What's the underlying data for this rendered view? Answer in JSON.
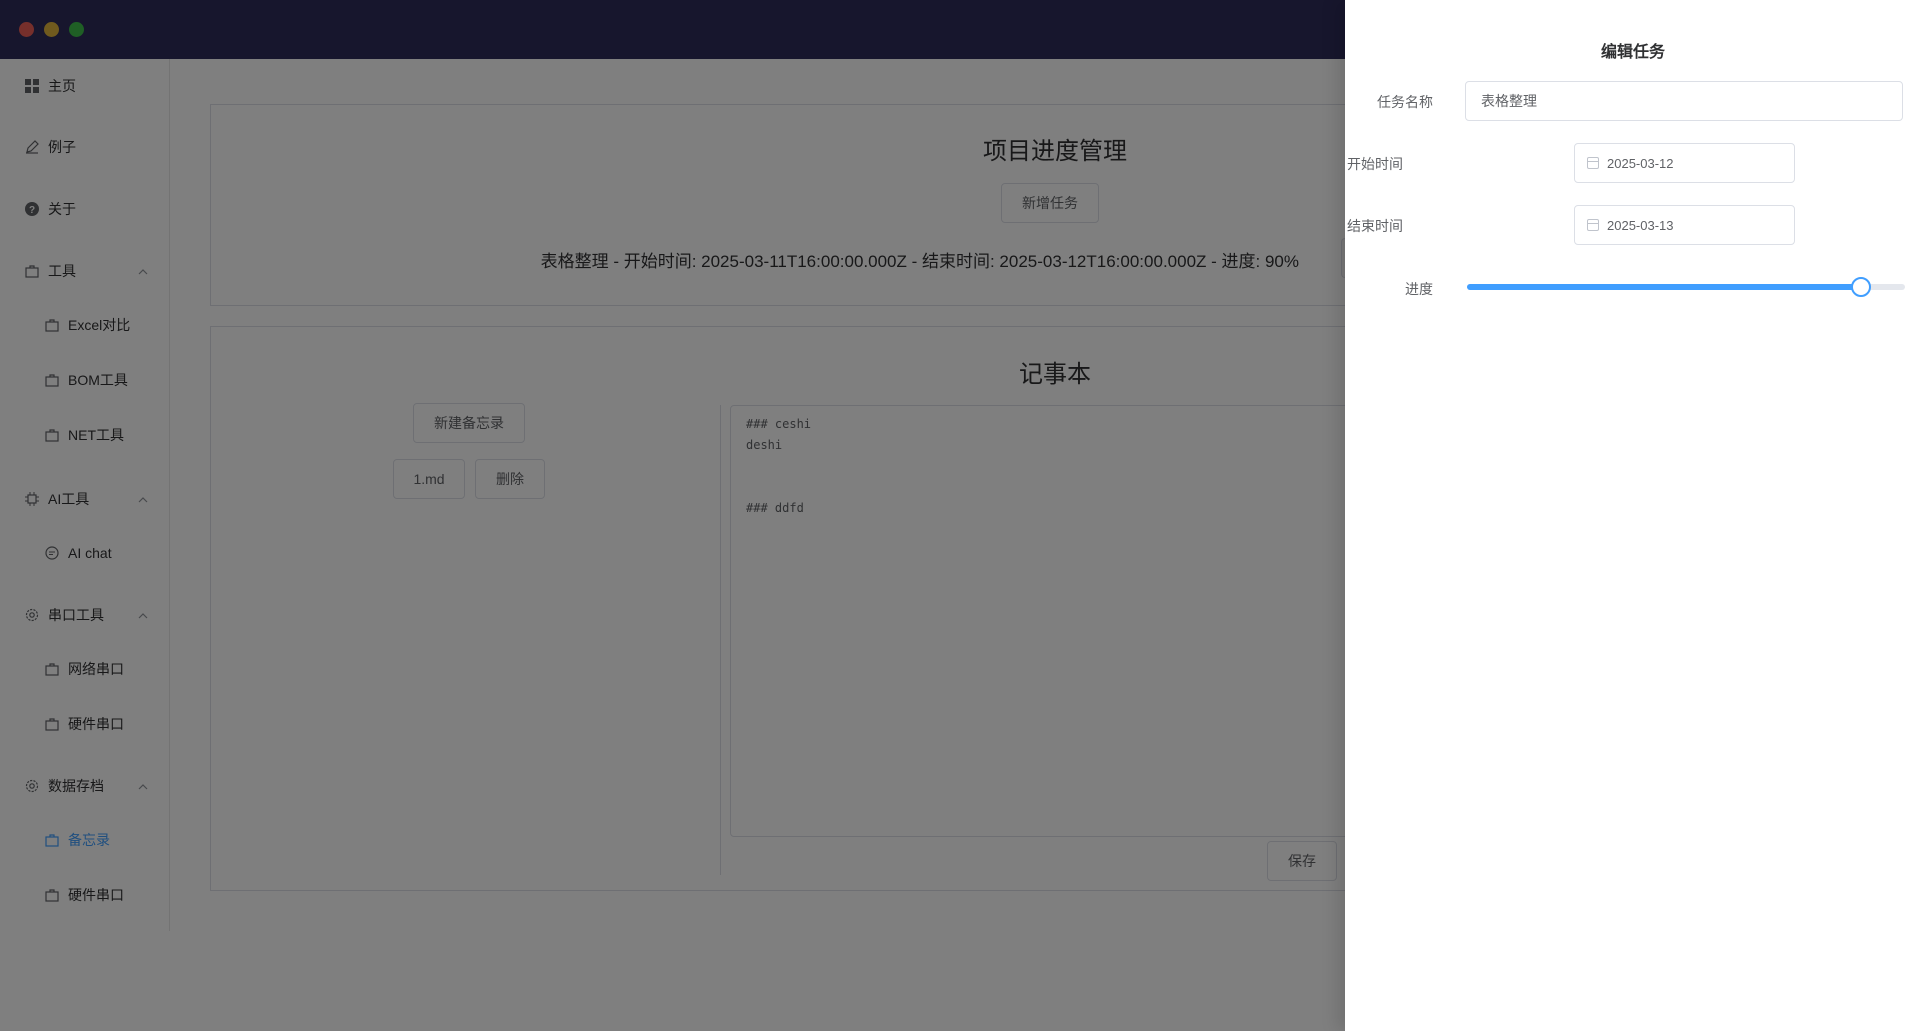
{
  "window": {
    "controls": [
      "close",
      "minimize",
      "maximize"
    ]
  },
  "sidebar": {
    "items": [
      {
        "label": "主页",
        "icon": "grid-icon"
      },
      {
        "label": "例子",
        "icon": "edit-icon"
      },
      {
        "label": "关于",
        "icon": "question-icon"
      },
      {
        "label": "工具",
        "icon": "briefcase-icon",
        "expanded": true
      },
      {
        "label": "Excel对比",
        "icon": "briefcase-icon"
      },
      {
        "label": "BOM工具",
        "icon": "briefcase-icon"
      },
      {
        "label": "NET工具",
        "icon": "briefcase-icon"
      },
      {
        "label": "AI工具",
        "icon": "cpu-icon",
        "expanded": true
      },
      {
        "label": "AI chat",
        "icon": "chat-icon"
      },
      {
        "label": "串口工具",
        "icon": "gear-icon",
        "expanded": true
      },
      {
        "label": "网络串口",
        "icon": "briefcase-icon"
      },
      {
        "label": "硬件串口",
        "icon": "briefcase-icon"
      },
      {
        "label": "数据存档",
        "icon": "gear-icon",
        "expanded": true
      },
      {
        "label": "备忘录",
        "icon": "briefcase-icon",
        "active": true
      },
      {
        "label": "硬件串口",
        "icon": "briefcase-icon"
      }
    ],
    "active_color": "#409eff"
  },
  "project": {
    "title": "项目进度管理",
    "add_task_label": "新增任务",
    "task_line": "表格整理 - 开始时间: 2025-03-11T16:00:00.000Z - 结束时间: 2025-03-12T16:00:00.000Z - 进度: 90%"
  },
  "notebook": {
    "title": "记事本",
    "new_memo_label": "新建备忘录",
    "file_label": "1.md",
    "delete_label": "删除",
    "editor_text": "### ceshi\ndeshi\n\n\n### ddfd",
    "save_label": "保存"
  },
  "drawer": {
    "title": "编辑任务",
    "task_name_label": "任务名称",
    "task_name_value": "表格整理",
    "start_label": "开始时间",
    "start_value": "2025-03-12",
    "end_label": "结束时间",
    "end_value": "2025-03-13",
    "progress_label": "进度",
    "progress_value": 90,
    "accent": "#409eff"
  },
  "colors": {
    "titlebar": "#2e2c5a",
    "overlay": "rgba(0,0,0,0.5)"
  }
}
